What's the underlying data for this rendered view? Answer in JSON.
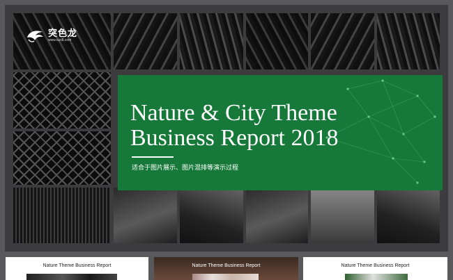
{
  "logo": {
    "name": "突色龙",
    "url": "www.tuzi8.com"
  },
  "slide": {
    "title_line1": "Nature & City Theme",
    "title_line2": "Business Report 2018",
    "subtitle": "适合于图片展示、图片混排等演示过程"
  },
  "thumbnails": [
    {
      "caption": "Nature Theme Business Report"
    },
    {
      "caption": "Nature Theme Business Report"
    },
    {
      "caption": "Nature Theme Business Report"
    }
  ],
  "colors": {
    "frame": "#59595b",
    "accent_green": "#16793a",
    "text_white": "#ffffff"
  },
  "icons": [
    "chameleon-logo-icon"
  ]
}
